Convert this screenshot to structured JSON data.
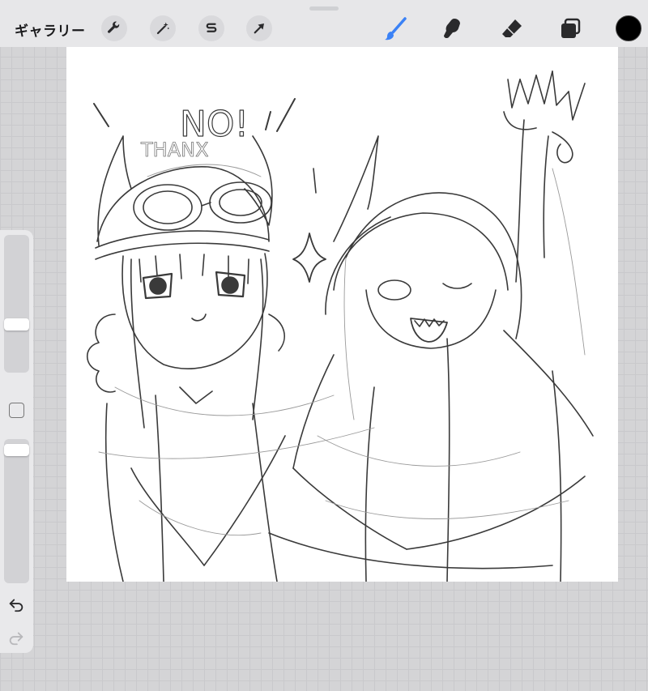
{
  "toolbar": {
    "gallery_label": "ギャラリー",
    "left_tools": [
      {
        "name": "actions",
        "icon": "wrench-icon"
      },
      {
        "name": "adjustments",
        "icon": "magic-wand-icon"
      },
      {
        "name": "selection",
        "icon": "selection-s-icon"
      },
      {
        "name": "transform",
        "icon": "arrow-cursor-icon"
      }
    ],
    "right_tools": [
      {
        "name": "brush",
        "icon": "brush-icon",
        "active": true
      },
      {
        "name": "smudge",
        "icon": "smudge-icon"
      },
      {
        "name": "eraser",
        "icon": "eraser-icon"
      },
      {
        "name": "layers",
        "icon": "layers-icon"
      }
    ],
    "accent_color": "#3b82f6",
    "current_color": "#000000"
  },
  "sidebar": {
    "brush_size_level": 0.31,
    "opacity_level": 0.95
  },
  "canvas": {
    "sketch_text": {
      "shout": "NO!",
      "thanks": "THANX"
    }
  }
}
